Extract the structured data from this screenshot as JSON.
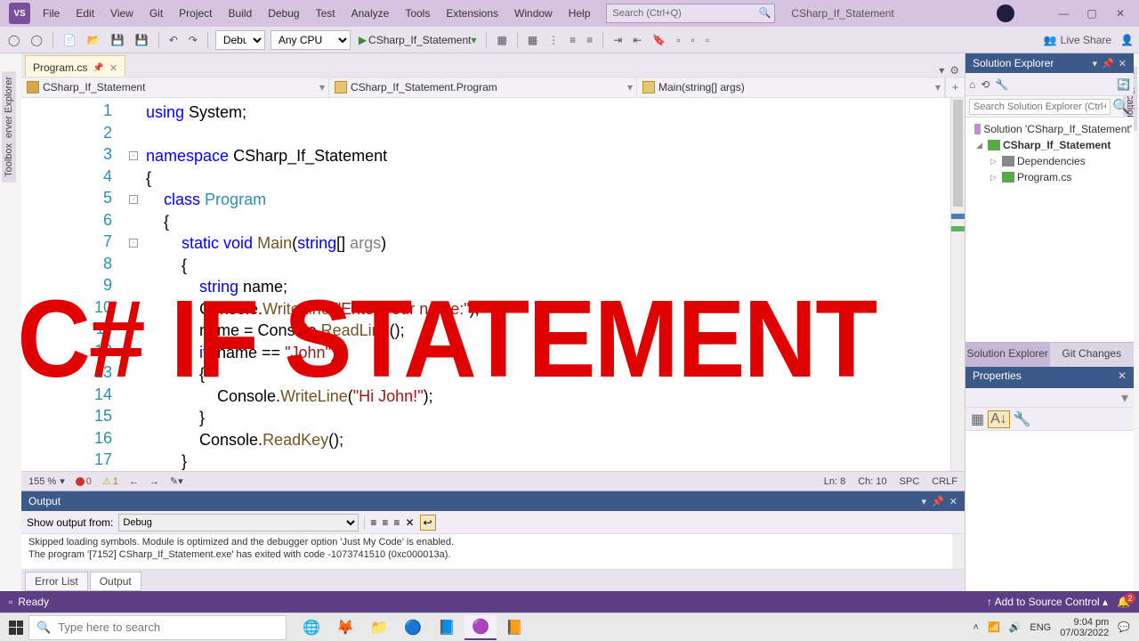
{
  "menu": {
    "items": [
      "File",
      "Edit",
      "View",
      "Git",
      "Project",
      "Build",
      "Debug",
      "Test",
      "Analyze",
      "Tools",
      "Extensions",
      "Window",
      "Help"
    ]
  },
  "titlebar": {
    "search_placeholder": "Search (Ctrl+Q)",
    "solution": "CSharp_If_Statement"
  },
  "toolbar": {
    "config": "Debug",
    "platform": "Any CPU",
    "run": "CSharp_If_Statement",
    "liveshare": "Live Share"
  },
  "sidetabs": {
    "left1": "Server Explorer",
    "left2": "Toolbox",
    "right": "Notifications"
  },
  "doctab": {
    "name": "Program.cs"
  },
  "nav": {
    "a": "CSharp_If_Statement",
    "b": "CSharp_If_Statement.Program",
    "c": "Main(string[] args)"
  },
  "code": {
    "l1a": "using",
    "l1b": " System;",
    "l3a": "namespace",
    "l3b": " CSharp_If_Statement",
    "l4": "{",
    "l5a": "    ",
    "l5b": "class",
    "l5c": " ",
    "l5d": "Program",
    "l6": "    {",
    "l7a": "        ",
    "l7b": "static",
    "l7c": " ",
    "l7d": "void",
    "l7e": " ",
    "l7f": "Main",
    "l7g": "(",
    "l7h": "string",
    "l7i": "[] ",
    "l7j": "args",
    "l7k": ")",
    "l8": "        {",
    "l9a": "            ",
    "l9b": "string",
    "l9c": " name;",
    "l10a": "            Console.",
    "l10b": "WriteLine",
    "l10c": "(",
    "l10d": "\"Enter your name:\"",
    "l10e": ");",
    "l11a": "            name = Console.",
    "l11b": "ReadLine",
    "l11c": "();",
    "l12a": "            ",
    "l12b": "if",
    "l12c": " (name == ",
    "l12d": "\"John\"",
    "l12e": ")",
    "l13": "            {",
    "l14a": "                Console.",
    "l14b": "WriteLine",
    "l14c": "(",
    "l14d": "\"Hi John!\"",
    "l14e": ");",
    "l15": "            }",
    "l16a": "            Console.",
    "l16b": "ReadKey",
    "l16c": "();",
    "l17": "        }"
  },
  "lines": [
    "1",
    "2",
    "3",
    "4",
    "5",
    "6",
    "7",
    "8",
    "9",
    "10",
    "11",
    "12",
    "13",
    "14",
    "15",
    "16",
    "17"
  ],
  "edstatus": {
    "zoom": "155 %",
    "errors": "0",
    "warnings": "1",
    "ln": "Ln: 8",
    "ch": "Ch: 10",
    "spc": "SPC",
    "crlf": "CRLF"
  },
  "output": {
    "title": "Output",
    "show_label": "Show output from:",
    "source": "Debug",
    "line1": "Skipped loading symbols. Module is optimized and the debugger option 'Just My Code' is enabled.",
    "line2": "The program '[7152] CSharp_If_Statement.exe' has exited with code -1073741510 (0xc000013a)."
  },
  "bottabs": {
    "a": "Error List",
    "b": "Output"
  },
  "se": {
    "title": "Solution Explorer",
    "search_placeholder": "Search Solution Explorer (Ctrl+;)",
    "sol": "Solution 'CSharp_If_Statement'",
    "prj": "CSharp_If_Statement",
    "dep": "Dependencies",
    "file": "Program.cs",
    "tab1": "Solution Explorer",
    "tab2": "Git Changes",
    "props": "Properties"
  },
  "statusbar": {
    "ready": "Ready",
    "addsrc": "Add to Source Control",
    "notif": "2"
  },
  "taskbar": {
    "search": "Type here to search",
    "lang": "ENG",
    "time": "9:04 pm",
    "date": "07/03/2022"
  },
  "overlay": "C#  IF STATEMENT"
}
